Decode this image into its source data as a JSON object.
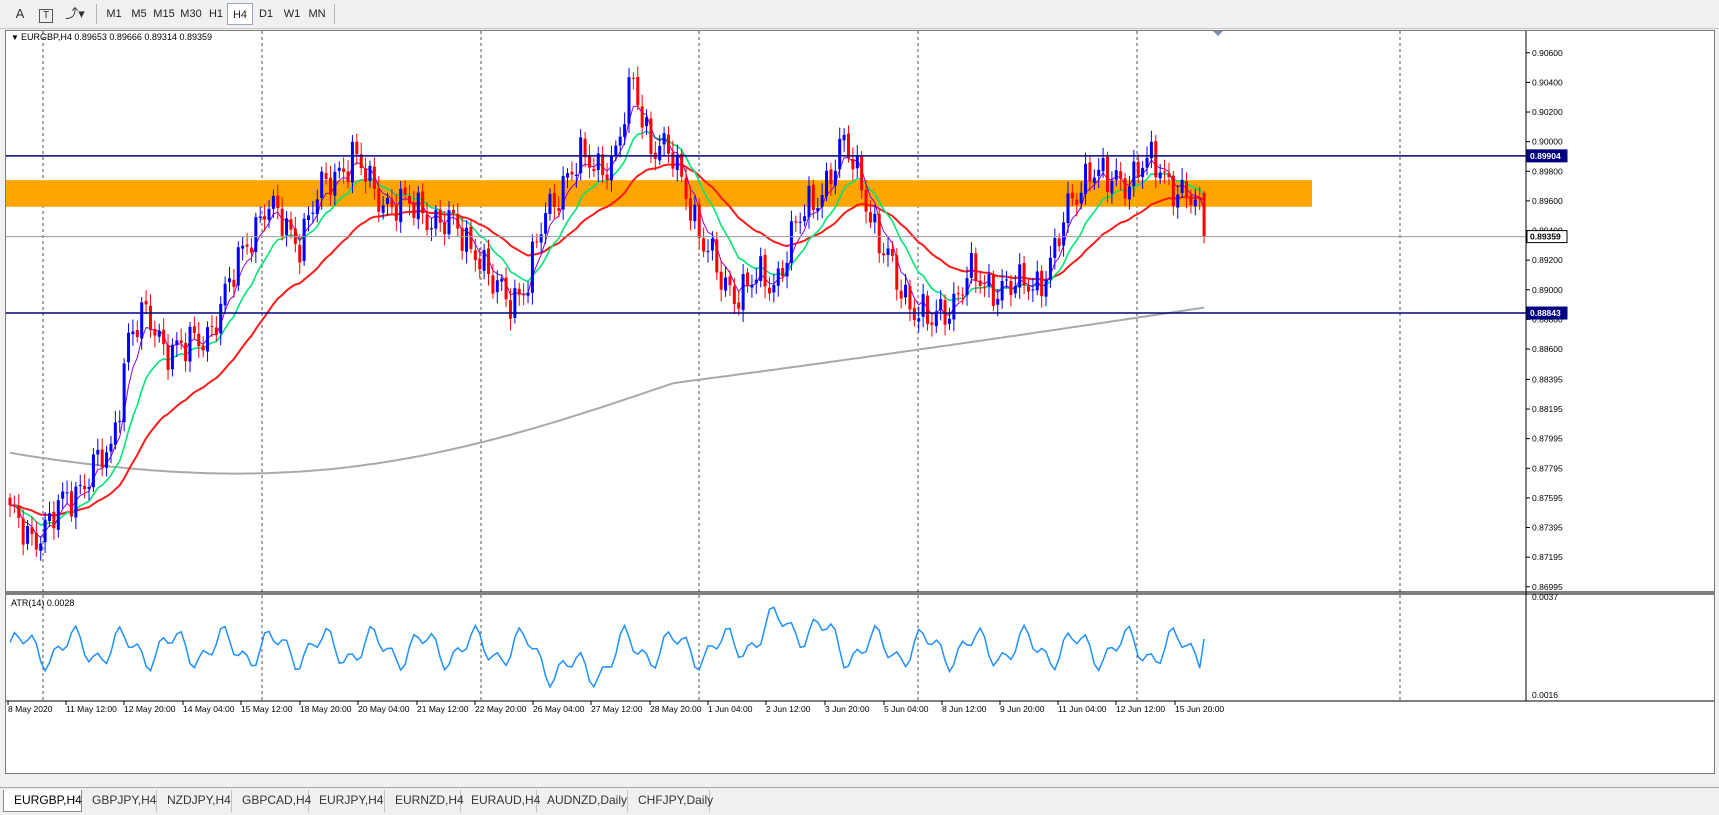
{
  "toolbar": {
    "text_tool": "A",
    "text_label_tool": "T",
    "arrows_tool_icon": "arrows-dropdown-icon",
    "timeframes": [
      "M1",
      "M5",
      "M15",
      "M30",
      "H1",
      "H4",
      "D1",
      "W1",
      "MN"
    ],
    "active_timeframe": "H4"
  },
  "chart": {
    "header": "EURGBP,H4  0.89653 0.89666 0.89314 0.89359",
    "symbol": "EURGBP",
    "timeframe": "H4",
    "ohlc": {
      "open": 0.89653,
      "high": 0.89666,
      "low": 0.89314,
      "close": 0.89359
    },
    "price_labels": [
      "0.90600",
      "0.90400",
      "0.90200",
      "0.90000",
      "0.89800",
      "0.89600",
      "0.89400",
      "0.89200",
      "0.89000",
      "0.88800",
      "0.88600",
      "0.88395",
      "0.88195",
      "0.87995",
      "0.87795",
      "0.87595",
      "0.87395",
      "0.87195",
      "0.86995"
    ],
    "price_range": [
      0.8698,
      0.9072
    ],
    "resistance_level": "0.89904",
    "support_level": "0.88843",
    "current_price": "0.89359",
    "supply_zone": [
      0.8956,
      0.8974
    ],
    "time_labels": [
      "8 May 2020",
      "11 May 12:00",
      "12 May 20:00",
      "14 May 04:00",
      "15 May 12:00",
      "18 May 20:00",
      "20 May 04:00",
      "21 May 12:00",
      "22 May 20:00",
      "26 May 04:00",
      "27 May 12:00",
      "28 May 20:00",
      "1 Jun 04:00",
      "2 Jun 12:00",
      "3 Jun 20:00",
      "5 Jun 04:00",
      "8 Jun 12:00",
      "9 Jun 20:00",
      "11 Jun 04:00",
      "12 Jun 12:00",
      "15 Jun 20:00"
    ],
    "colors": {
      "bull": "#0000ff",
      "bear": "#ff0000",
      "ma_fast": "#9400d3",
      "ma_mid": "#00e676",
      "ma_slow": "#ff1a1a",
      "ma_long": "#a9a9a9",
      "level_line": "#000080",
      "zone": "#ffa500",
      "atr": "#1e90ff"
    }
  },
  "indicator": {
    "label": "ATR(14) 0.0028",
    "scale": [
      "0.0037",
      "0.0016"
    ],
    "range": [
      0.0016,
      0.0037
    ]
  },
  "tabs": [
    "EURGBP,H4",
    "GBPJPY,H4",
    "NZDJPY,H4",
    "GBPCAD,H4",
    "EURJPY,H4",
    "EURNZD,H4",
    "EURAUD,H4",
    "AUDNZD,Daily",
    "CHFJPY,Daily"
  ],
  "active_tab": "EURGBP,H4",
  "chart_data": {
    "type": "candlestick",
    "symbol": "EURGBP",
    "timeframe": "H4",
    "anchors": [
      [
        0,
        0.8745
      ],
      [
        5,
        0.8735
      ],
      [
        9,
        0.874
      ],
      [
        13,
        0.876
      ],
      [
        18,
        0.8775
      ],
      [
        23,
        0.879
      ],
      [
        27,
        0.887
      ],
      [
        31,
        0.888
      ],
      [
        35,
        0.8865
      ],
      [
        40,
        0.8858
      ],
      [
        45,
        0.8872
      ],
      [
        50,
        0.89
      ],
      [
        54,
        0.8935
      ],
      [
        58,
        0.8955
      ],
      [
        62,
        0.8945
      ],
      [
        66,
        0.8935
      ],
      [
        70,
        0.896
      ],
      [
        74,
        0.898
      ],
      [
        78,
        0.899
      ],
      [
        82,
        0.897
      ],
      [
        86,
        0.896
      ],
      [
        90,
        0.8955
      ],
      [
        94,
        0.8955
      ],
      [
        98,
        0.8945
      ],
      [
        102,
        0.894
      ],
      [
        106,
        0.893
      ],
      [
        110,
        0.89
      ],
      [
        114,
        0.8895
      ],
      [
        118,
        0.8905
      ],
      [
        122,
        0.895
      ],
      [
        126,
        0.8975
      ],
      [
        130,
        0.8985
      ],
      [
        134,
        0.8985
      ],
      [
        138,
        0.899
      ],
      [
        142,
        0.904
      ],
      [
        146,
        0.9
      ],
      [
        150,
        0.899
      ],
      [
        154,
        0.897
      ],
      [
        158,
        0.893
      ],
      [
        162,
        0.8905
      ],
      [
        166,
        0.89
      ],
      [
        170,
        0.8905
      ],
      [
        174,
        0.8905
      ],
      [
        178,
        0.8935
      ],
      [
        182,
        0.8955
      ],
      [
        186,
        0.8975
      ],
      [
        190,
        0.8995
      ],
      [
        194,
        0.8975
      ],
      [
        198,
        0.893
      ],
      [
        202,
        0.8905
      ],
      [
        206,
        0.889
      ],
      [
        210,
        0.8875
      ],
      [
        214,
        0.889
      ],
      [
        218,
        0.891
      ],
      [
        222,
        0.89
      ],
      [
        226,
        0.8905
      ],
      [
        230,
        0.89
      ],
      [
        234,
        0.8905
      ],
      [
        238,
        0.8925
      ],
      [
        242,
        0.896
      ],
      [
        246,
        0.8985
      ],
      [
        250,
        0.897
      ],
      [
        254,
        0.8975
      ],
      [
        258,
        0.8985
      ],
      [
        262,
        0.898
      ],
      [
        266,
        0.897
      ],
      [
        270,
        0.8955
      ],
      [
        272,
        0.8936
      ]
    ],
    "moving_averages": [
      {
        "period": 5,
        "color": "purple"
      },
      {
        "period": 13,
        "color": "green"
      },
      {
        "period": 34,
        "color": "red"
      },
      {
        "period": 200,
        "color": "gray"
      }
    ],
    "levels": [
      0.89904,
      0.88843
    ],
    "current_price": 0.89359,
    "atr_period": 14,
    "atr_last": 0.0028,
    "atr_range": [
      0.0016,
      0.0037
    ]
  }
}
